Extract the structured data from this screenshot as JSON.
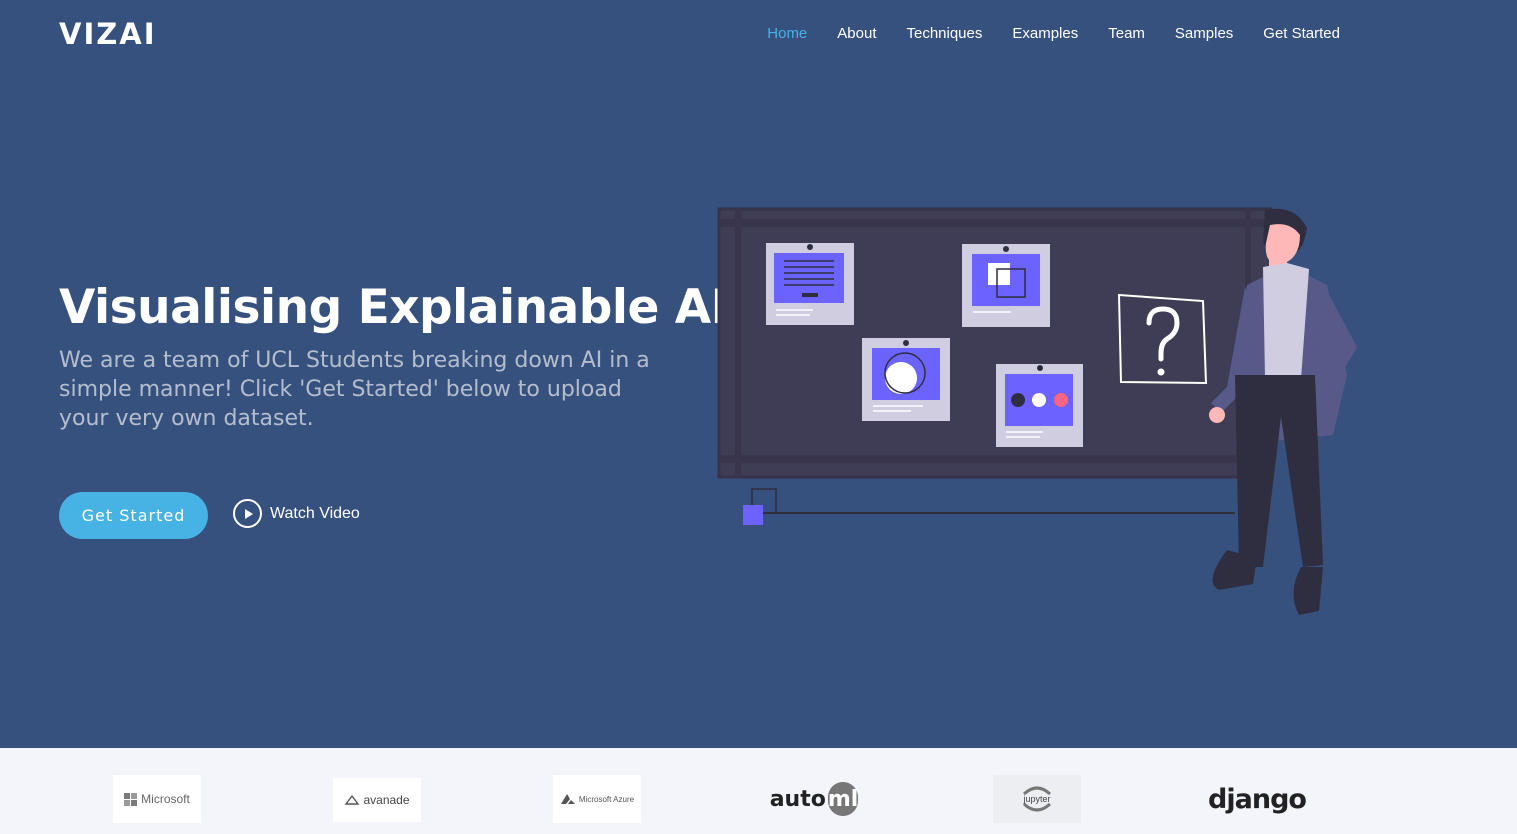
{
  "brand": {
    "logo": "VIZAI"
  },
  "nav": {
    "items": [
      {
        "label": "Home",
        "active": true
      },
      {
        "label": "About",
        "active": false
      },
      {
        "label": "Techniques",
        "active": false
      },
      {
        "label": "Examples",
        "active": false
      },
      {
        "label": "Team",
        "active": false
      },
      {
        "label": "Samples",
        "active": false
      },
      {
        "label": "Get Started",
        "active": false
      }
    ]
  },
  "hero": {
    "title": "Visualising Explainable AI",
    "subtitle": "We are a team of UCL Students breaking down AI in a simple manner! Click 'Get Started' below to upload your very own dataset.",
    "cta_label": "Get Started",
    "video_label": "Watch Video"
  },
  "clients": {
    "microsoft": "Microsoft",
    "avanade": "avanade",
    "azure": "Microsoft Azure",
    "automl_a": "auto",
    "automl_b": "ml",
    "jupyter": "jupyter",
    "django": "django"
  },
  "colors": {
    "background": "#37517e",
    "accent": "#47b2e4",
    "clients_bg": "#f3f5fa",
    "board": "#3f3d56",
    "purple": "#6c63ff"
  }
}
